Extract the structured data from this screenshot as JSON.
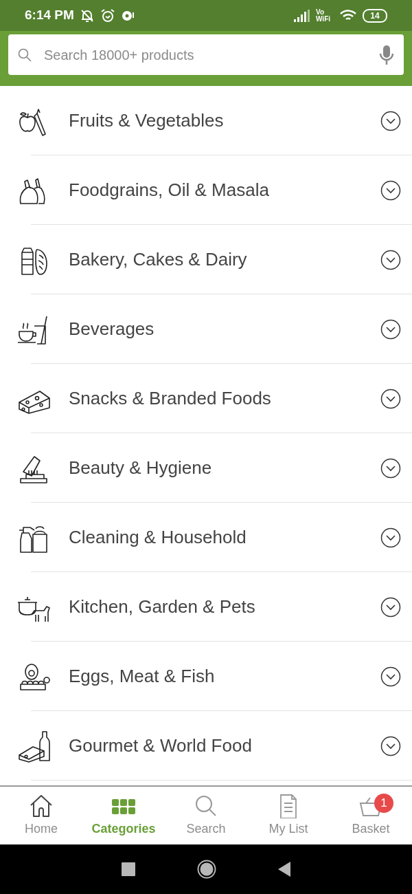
{
  "status_bar": {
    "time": "6:14 PM",
    "network_label": "Vo WiFi",
    "battery": "14"
  },
  "search": {
    "placeholder": "Search 18000+ products"
  },
  "categories": [
    {
      "label": "Fruits & Vegetables",
      "kind": "fruit"
    },
    {
      "label": "Foodgrains, Oil & Masala",
      "kind": "grains"
    },
    {
      "label": "Bakery, Cakes & Dairy",
      "kind": "bakery"
    },
    {
      "label": "Beverages",
      "kind": "beverage"
    },
    {
      "label": "Snacks & Branded Foods",
      "kind": "snacks"
    },
    {
      "label": "Beauty & Hygiene",
      "kind": "beauty"
    },
    {
      "label": "Cleaning & Household",
      "kind": "cleaning"
    },
    {
      "label": "Kitchen, Garden & Pets",
      "kind": "kitchen"
    },
    {
      "label": "Eggs, Meat & Fish",
      "kind": "eggs"
    },
    {
      "label": "Gourmet & World Food",
      "kind": "gourmet"
    }
  ],
  "bottom_nav": [
    {
      "label": "Home",
      "kind": "home",
      "selected": false
    },
    {
      "label": "Categories",
      "kind": "grid",
      "selected": true
    },
    {
      "label": "Search",
      "kind": "search",
      "selected": false
    },
    {
      "label": "My List",
      "kind": "list",
      "selected": false
    },
    {
      "label": "Basket",
      "kind": "basket",
      "selected": false,
      "badge": "1"
    }
  ]
}
